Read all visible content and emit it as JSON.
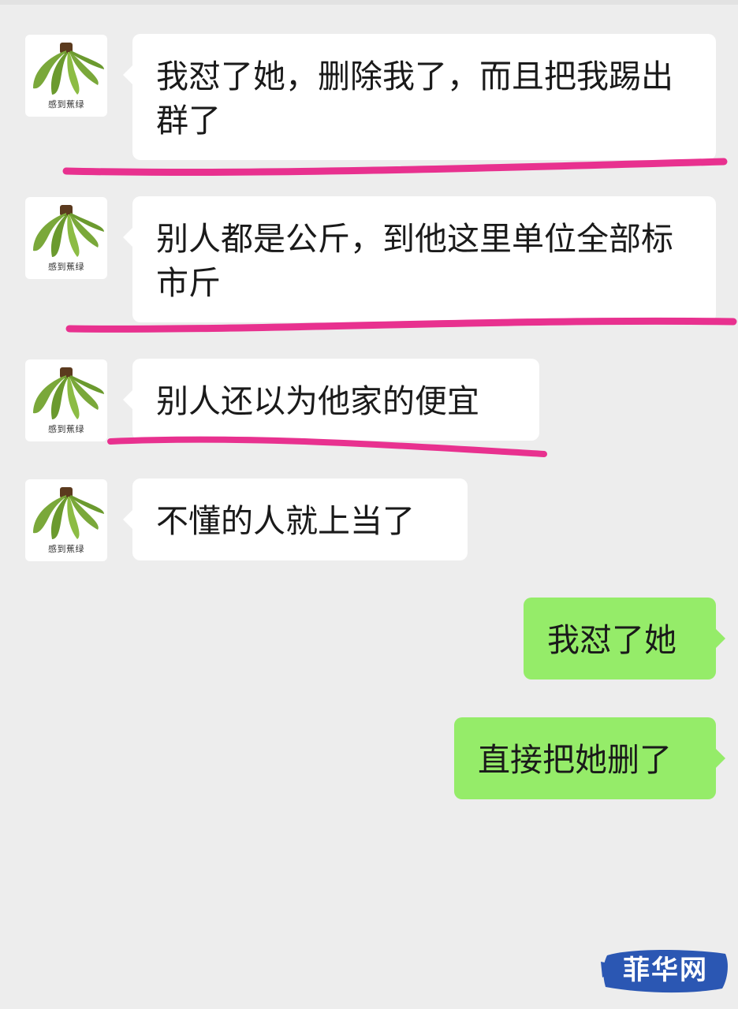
{
  "contact": {
    "avatar_caption": "感到蕉绿"
  },
  "messages": [
    {
      "side": "in",
      "text": "我怼了她，删除我了，而且把我踢出群了"
    },
    {
      "side": "in",
      "text": "别人都是公斤，到他这里单位全部标市斤"
    },
    {
      "side": "in",
      "text": "别人还以为他家的便宜"
    },
    {
      "side": "in",
      "text": "不懂的人就上当了"
    },
    {
      "side": "out",
      "text": "我怼了她"
    },
    {
      "side": "out",
      "text": "直接把她删了"
    }
  ],
  "watermark": {
    "text": "菲华网"
  },
  "colors": {
    "background": "#ededed",
    "incoming_bubble": "#ffffff",
    "outgoing_bubble": "#95ec69",
    "annotation_underline": "#e8318f",
    "watermark_bg": "#2b57b3"
  }
}
